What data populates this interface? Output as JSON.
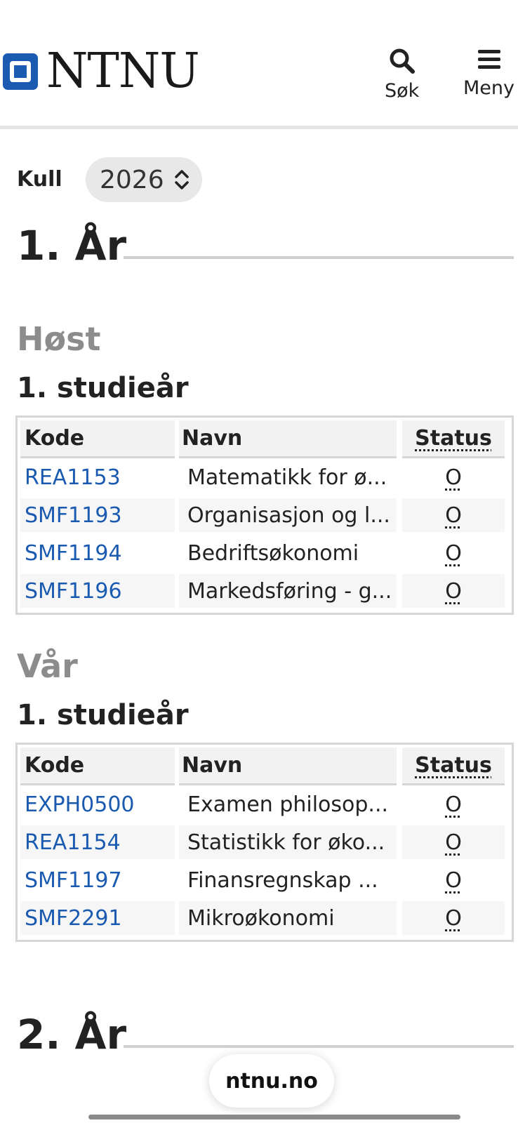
{
  "header": {
    "logo_text": "NTNU",
    "search_label": "Søk",
    "menu_label": "Meny"
  },
  "kull": {
    "label": "Kull",
    "selected_year": "2026"
  },
  "year1": {
    "heading": "1. År",
    "semesters": [
      {
        "season": "Høst",
        "study_year": "1. studieår",
        "columns": [
          "Kode",
          "Navn",
          "Status"
        ],
        "rows": [
          {
            "code": "REA1153",
            "name": "Matematikk for ø...",
            "status": "O"
          },
          {
            "code": "SMF1193",
            "name": "Organisasjon og l...",
            "status": "O"
          },
          {
            "code": "SMF1194",
            "name": "Bedriftsøkonomi",
            "status": "O"
          },
          {
            "code": "SMF1196",
            "name": "Markedsføring - g...",
            "status": "O"
          }
        ]
      },
      {
        "season": "Vår",
        "study_year": "1. studieår",
        "columns": [
          "Kode",
          "Navn",
          "Status"
        ],
        "rows": [
          {
            "code": "EXPH0500",
            "name": "Examen philosop...",
            "status": "O"
          },
          {
            "code": "REA1154",
            "name": "Statistikk for øko...",
            "status": "O"
          },
          {
            "code": "SMF1197",
            "name": "Finansregnskap ...",
            "status": "O"
          },
          {
            "code": "SMF2291",
            "name": "Mikroøkonomi",
            "status": "O"
          }
        ]
      }
    ]
  },
  "year2": {
    "heading": "2. År"
  },
  "browser": {
    "url": "ntnu.no"
  },
  "colors": {
    "link": "#1a5ab0",
    "brand": "#1a5ab0",
    "season_gray": "#8c8c8c"
  }
}
